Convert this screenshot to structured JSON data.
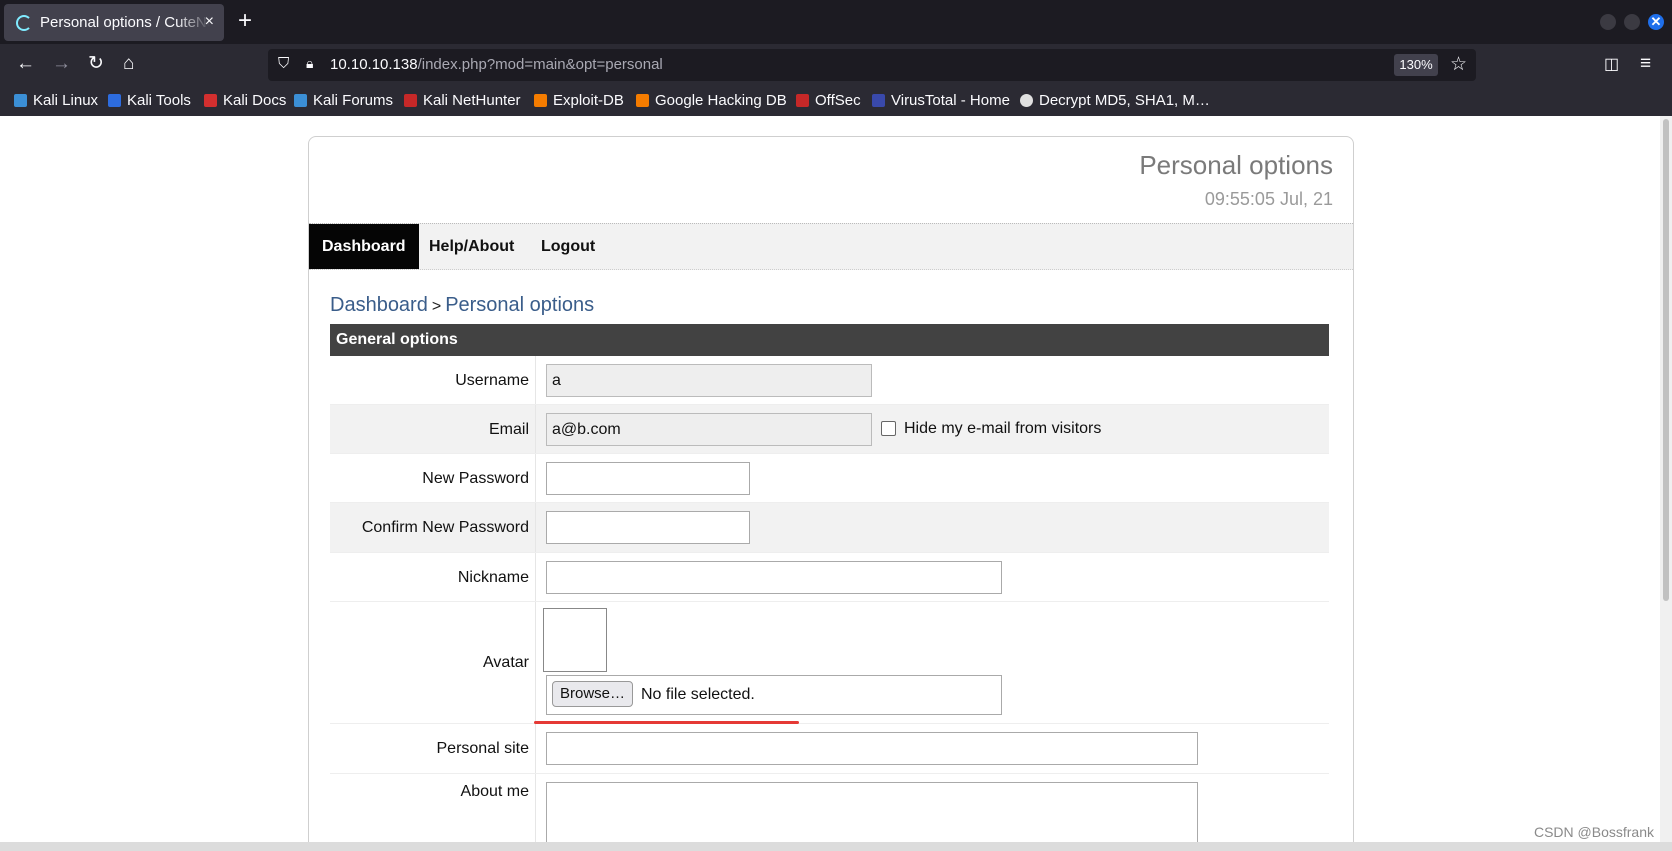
{
  "browser": {
    "tab_title": "Personal options / CuteNews",
    "tab_close": "×",
    "new_tab": "+",
    "url_host": "10.10.10.138",
    "url_path": "/index.php?mod=main&opt=personal",
    "zoom": "130%",
    "bookmarks": [
      {
        "label": "Kali Linux",
        "color": "#3b8fd6"
      },
      {
        "label": "Kali Tools",
        "color": "#2d6cdf"
      },
      {
        "label": "Kali Docs",
        "color": "#d32f2f"
      },
      {
        "label": "Kali Forums",
        "color": "#3b8fd6"
      },
      {
        "label": "Kali NetHunter",
        "color": "#c62828"
      },
      {
        "label": "Exploit-DB",
        "color": "#f57c00"
      },
      {
        "label": "Google Hacking DB",
        "color": "#f57c00"
      },
      {
        "label": "OffSec",
        "color": "#c62828"
      },
      {
        "label": "VirusTotal - Home",
        "color": "#3949ab"
      },
      {
        "label": "Decrypt MD5, SHA1, M…",
        "color": "#e0e0e0"
      }
    ]
  },
  "header": {
    "title": "Personal options",
    "time": "09:55:05 Jul, 21"
  },
  "menu": {
    "dashboard": "Dashboard",
    "help": "Help/About",
    "logout": "Logout"
  },
  "breadcrumb": {
    "root": "Dashboard",
    "sep": ">",
    "current": "Personal options"
  },
  "section": {
    "title": "General options"
  },
  "form": {
    "username_label": "Username",
    "username_value": "a",
    "email_label": "Email",
    "email_value": "a@b.com",
    "hide_email_label": "Hide my e-mail from visitors",
    "new_password_label": "New Password",
    "confirm_password_label": "Confirm New Password",
    "nickname_label": "Nickname",
    "avatar_label": "Avatar",
    "browse_label": "Browse…",
    "no_file": "No file selected.",
    "personal_site_label": "Personal site",
    "about_me_label": "About me"
  },
  "watermark": "CSDN @Bossfrank"
}
